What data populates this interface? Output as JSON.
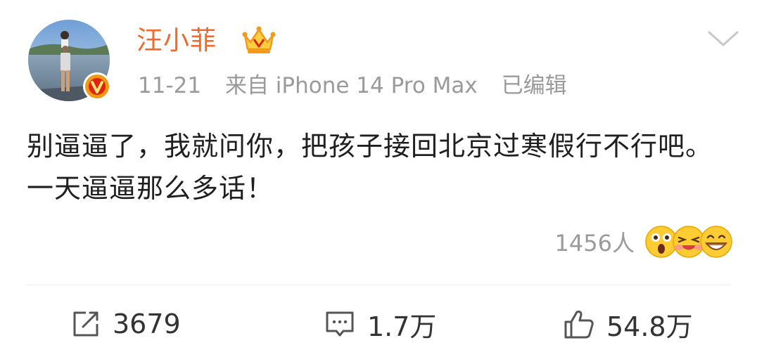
{
  "post": {
    "username": "汪小菲",
    "date": "11-21",
    "source": "来自 iPhone 14 Pro Max",
    "edited": "已编辑",
    "text": "别逼逼了，我就问你，把孩子接回北京过寒假行不行吧。一天逼逼那么多话！"
  },
  "reactions": {
    "count": "1456人",
    "emojis": [
      "surprised-emoji",
      "laughing-emoji",
      "grin-emoji"
    ]
  },
  "actions": {
    "repost_count": "3679",
    "comment_count": "1.7万",
    "like_count": "54.8万"
  },
  "colors": {
    "username": "#f06a2b",
    "meta": "#9a9a9a",
    "text": "#1f1f1f",
    "verify_badge": "#f29b12"
  }
}
